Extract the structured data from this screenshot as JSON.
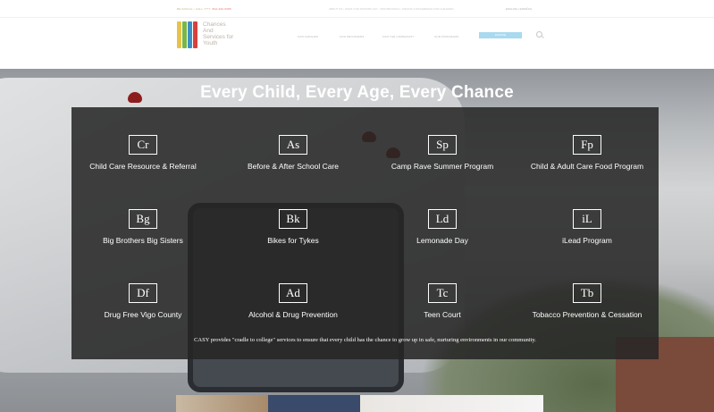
{
  "topbar": {
    "left_text": "BE SOCIAL • CALL 7777:",
    "left_number": "812-232-6305",
    "mid_text": "ABOUT US  •  WHAT OUR DONORS SAY  •  TESTIMONIALS  •  MAKING A DIFFERENCE FOR CHILDREN",
    "right_text": "ENGLISH  |  ESPAÑOL"
  },
  "logo": {
    "line1": "Chances",
    "line2": "And",
    "line3": "Services for",
    "line4": "Youth",
    "colors": [
      "#e7c34a",
      "#7ab648",
      "#3f8fc6",
      "#d6423b"
    ]
  },
  "nav": {
    "items": [
      "FOR FAMILIES",
      "FOR PROVIDERS",
      "FOR THE COMMUNITY",
      "OUR PROGRAMS"
    ],
    "donate": "DONATE"
  },
  "hero": {
    "title": "Every Child, Every Age, Every Chance"
  },
  "programs": [
    {
      "sym": "Cr",
      "label": "Child Care Resource & Referral"
    },
    {
      "sym": "As",
      "label": "Before & After School Care"
    },
    {
      "sym": "Sp",
      "label": "Camp Rave Summer Program"
    },
    {
      "sym": "Fp",
      "label": "Child & Adult Care Food Program"
    },
    {
      "sym": "Bg",
      "label": "Big Brothers Big Sisters"
    },
    {
      "sym": "Bk",
      "label": "Bikes for Tykes"
    },
    {
      "sym": "Ld",
      "label": "Lemonade Day"
    },
    {
      "sym": "iL",
      "label": "iLead Program"
    },
    {
      "sym": "Df",
      "label": "Drug Free Vigo County"
    },
    {
      "sym": "Ad",
      "label": "Alcohol & Drug Prevention"
    },
    {
      "sym": "Tc",
      "label": "Teen Court"
    },
    {
      "sym": "Tb",
      "label": "Tobacco Prevention & Cessation"
    }
  ],
  "mission": "CASY provides \"cradle to college\" services to ensure that every child has the chance to grow up in safe, nurturing environments in our community.",
  "colors": {
    "panel": "#262626",
    "donate": "#a9d9ef",
    "accent_red": "#e46a5a"
  }
}
